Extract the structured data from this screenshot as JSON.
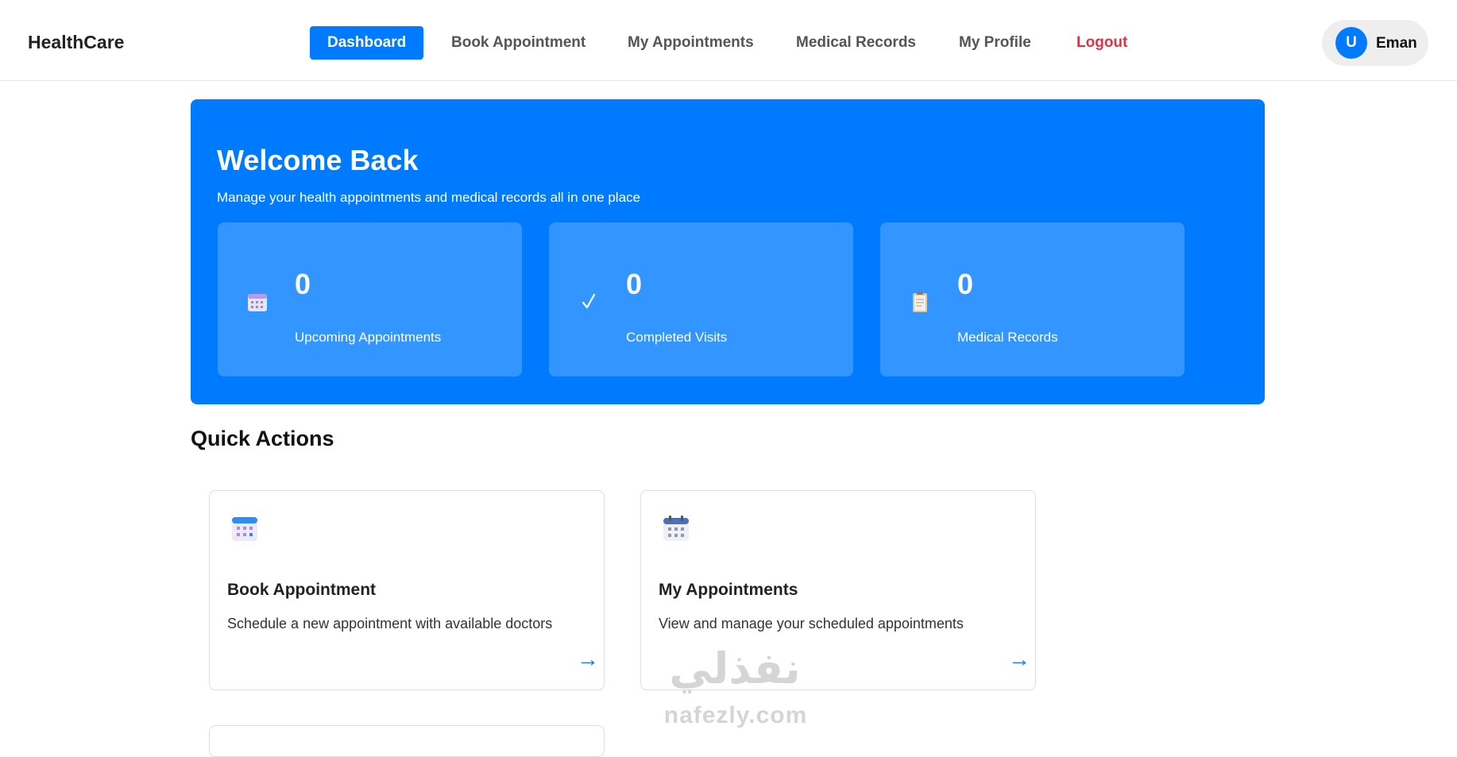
{
  "navbar": {
    "brand": "HealthCare",
    "links": [
      {
        "label": "Dashboard",
        "active": true
      },
      {
        "label": "Book Appointment"
      },
      {
        "label": "My Appointments"
      },
      {
        "label": "Medical Records"
      },
      {
        "label": "My Profile"
      },
      {
        "label": "Logout"
      }
    ],
    "user": {
      "initial": "U",
      "name": "Eman"
    }
  },
  "hero": {
    "title": "Welcome Back",
    "subtitle": "Manage your health appointments and medical records all in one place",
    "stats": [
      {
        "value": "0",
        "label": "Upcoming Appointments",
        "icon": "calendar-icon"
      },
      {
        "value": "0",
        "label": "Completed Visits",
        "icon": "check-icon"
      },
      {
        "value": "0",
        "label": "Medical Records",
        "icon": "clipboard-icon"
      }
    ]
  },
  "quick_actions": {
    "title": "Quick Actions",
    "cards": [
      {
        "title": "Book Appointment",
        "description": "Schedule a new appointment with available doctors",
        "arrow": "→",
        "icon": "calendar-icon"
      },
      {
        "title": "My Appointments",
        "description": "View and manage your scheduled appointments",
        "arrow": "→",
        "icon": "calendar-spiral-icon"
      }
    ]
  },
  "watermark": {
    "arabic": "نفذلي",
    "domain": "nafezly.com"
  },
  "colors": {
    "primary": "#007bff",
    "danger": "#dc3545",
    "text": "#222222"
  }
}
